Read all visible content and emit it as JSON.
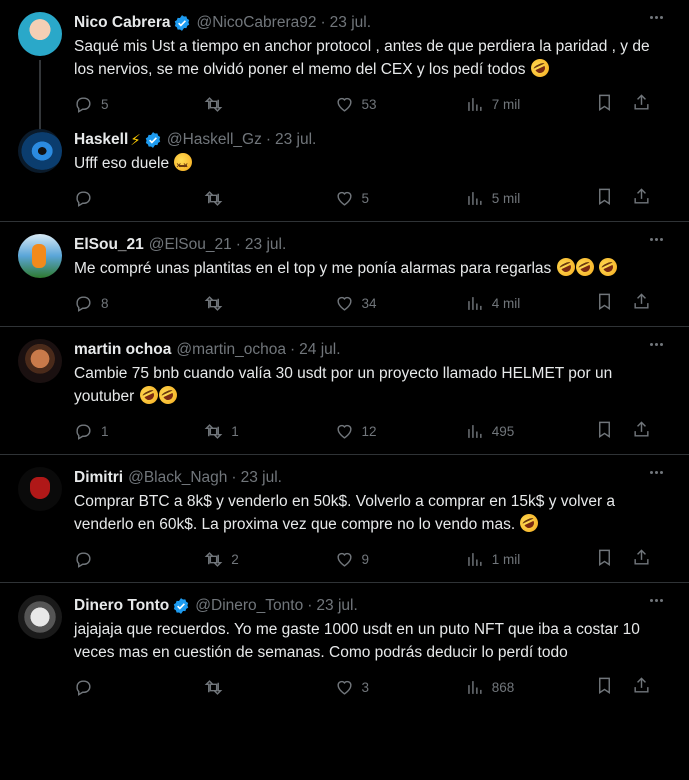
{
  "tweets": [
    {
      "name": "Nico Cabrera",
      "verified": true,
      "handle": "@NicoCabrera92",
      "date": "23 jul.",
      "text": "Saqué mis Ust a tiempo en anchor protocol , antes de que perdiera la paridad , y de los nervios, se me olvidó poner el memo del CEX y los pedí todos",
      "emoji": "rolling-on-floor-laughing",
      "replies": "5",
      "retweets": "",
      "likes": "53",
      "views": "7 mil"
    },
    {
      "name": "Haskell",
      "name_suffix": "⚡",
      "verified": true,
      "handle": "@Haskell_Gz",
      "date": "23 jul.",
      "text": "Ufff eso duele",
      "emoji": "confounded-face",
      "replies": "",
      "retweets": "",
      "likes": "5",
      "views": "5 mil"
    },
    {
      "name": "ElSou_21",
      "verified": false,
      "handle": "@ElSou_21",
      "date": "23 jul.",
      "text": "Me compré unas plantitas en el top y me ponía alarmas para regarlas",
      "emoji": "rolling-on-floor-laughing x3",
      "replies": "8",
      "retweets": "",
      "likes": "34",
      "views": "4 mil"
    },
    {
      "name": "martin ochoa",
      "verified": false,
      "handle": "@martin_ochoa",
      "date": "24 jul.",
      "text": "Cambie 75 bnb cuando valía 30 usdt por un proyecto llamado HELMET por un youtuber",
      "emoji": "rolling-on-floor-laughing x2",
      "replies": "1",
      "retweets": "1",
      "likes": "12",
      "views": "495"
    },
    {
      "name": "Dimitri",
      "verified": false,
      "handle": "@Black_Nagh",
      "date": "23 jul.",
      "text": "Comprar BTC a 8k$ y venderlo en 50k$. Volverlo a comprar en 15k$ y volver a venderlo en 60k$. La proxima vez que compre no lo vendo mas.",
      "emoji": "rolling-on-floor-laughing",
      "replies": "",
      "retweets": "2",
      "likes": "9",
      "views": "1 mil"
    },
    {
      "name": "Dinero Tonto",
      "verified": true,
      "handle": "@Dinero_Tonto",
      "date": "23 jul.",
      "text": "jajajaja que recuerdos. Yo me gaste 1000 usdt en un puto NFT que iba a costar 10 veces mas en cuestión de semanas. Como podrás deducir lo perdí todo",
      "replies": "",
      "retweets": "",
      "likes": "3",
      "views": "868"
    }
  ],
  "colors": {
    "background": "#000000",
    "text": "#e7e9ea",
    "muted": "#71767b",
    "separator": "#2f3336",
    "verified": "#1d9bf0"
  }
}
